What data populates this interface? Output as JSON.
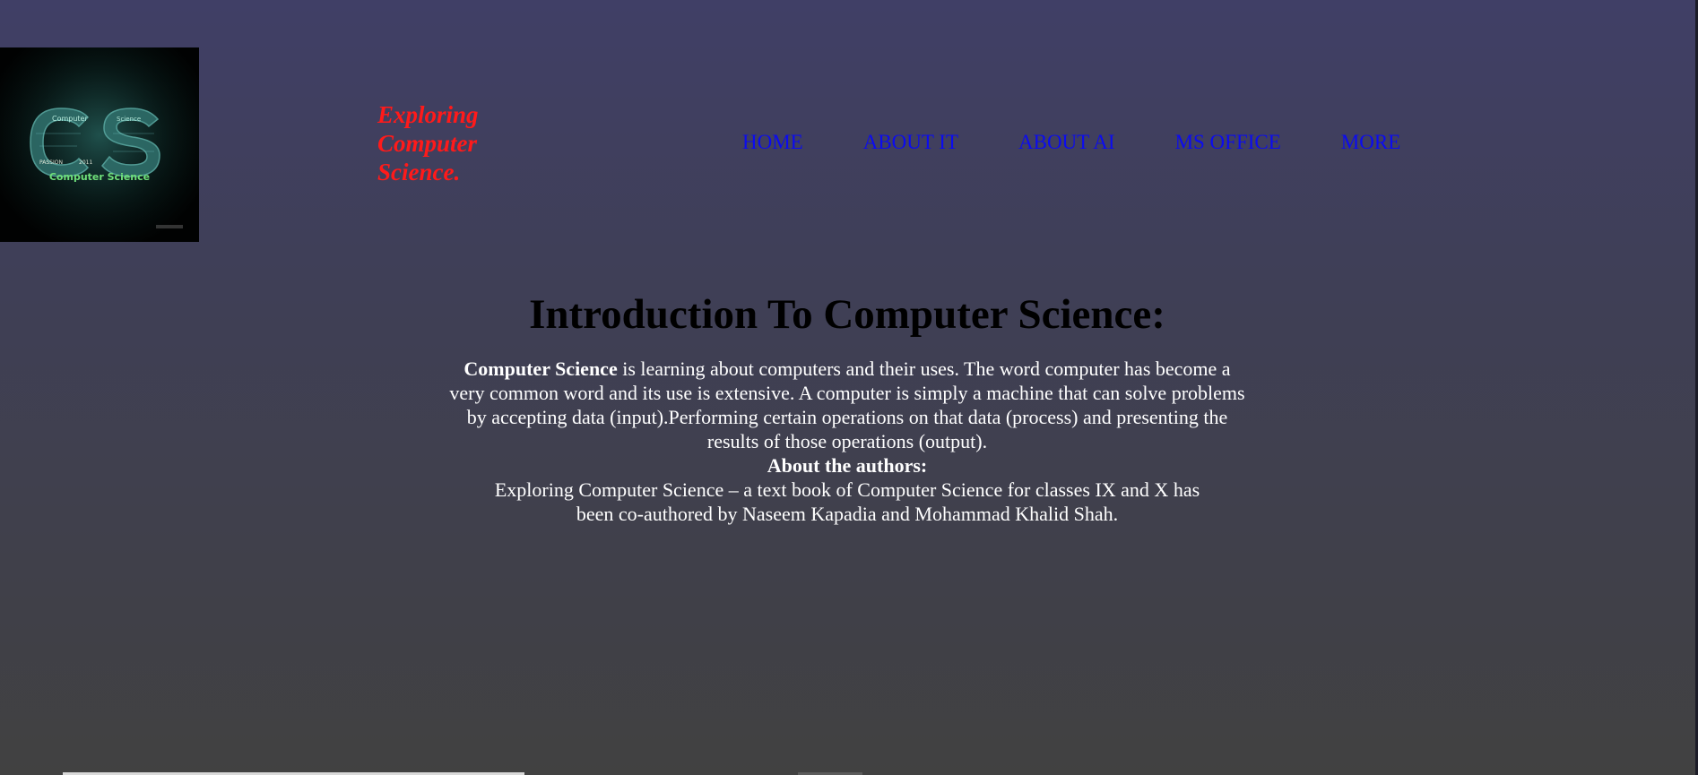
{
  "logo": {
    "letters": "CS",
    "caption": "Computer Science",
    "words": [
      "Computer",
      "Science",
      "PASSION",
      "2011"
    ]
  },
  "brand": {
    "title": "Exploring Computer Science."
  },
  "nav": {
    "items": [
      {
        "label": "HOME"
      },
      {
        "label": "ABOUT IT"
      },
      {
        "label": "ABOUT AI"
      },
      {
        "label": "MS OFFICE"
      },
      {
        "label": "MORE"
      }
    ]
  },
  "main": {
    "heading": "Introduction To Computer Science:",
    "intro_bold": "Computer Science",
    "intro_text": " is learning about computers and their uses. The word computer has become a very common word and its use is extensive. A computer is simply a machine that can solve problems by accepting data (input).Performing certain operations on that data (process) and presenting the results of those operations (output).",
    "authors_heading": "About the authors:",
    "authors_text": "Exploring Computer Science – a text book of Computer Science for classes IX and X has been co-authored by Naseem Kapadia and Mohammad Khalid Shah."
  },
  "colors": {
    "brand": "#ff1a1a",
    "nav_link": "#0b0bf0",
    "heading": "#000000",
    "body_text": "#ffffff"
  }
}
